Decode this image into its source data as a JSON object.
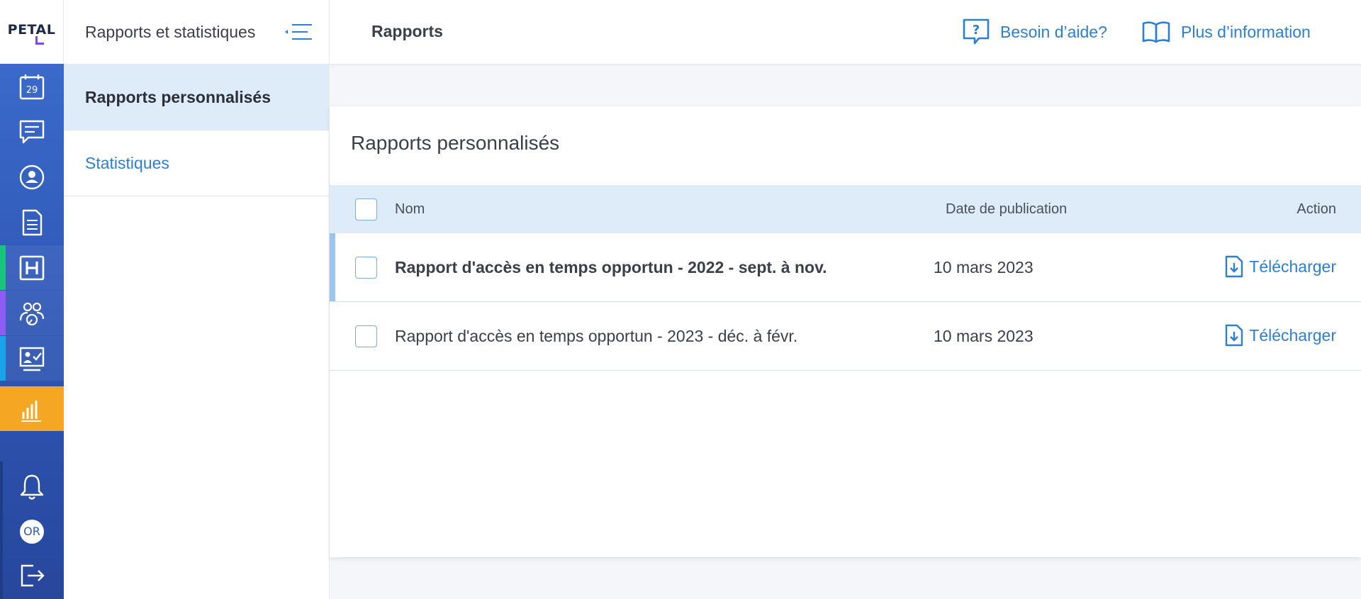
{
  "brand": {
    "logo_text": "PETAL"
  },
  "rail": {
    "calendar_day": "29",
    "avatar_initials": "OR",
    "accent_colors": {
      "green": "#1bc47d",
      "purple": "#8e5cf0",
      "cyan": "#1aa3e8",
      "active": "#f5a623"
    }
  },
  "sidebar": {
    "title": "Rapports et statistiques",
    "items": [
      {
        "label": "Rapports personnalisés",
        "active": true
      },
      {
        "label": "Statistiques",
        "active": false
      }
    ]
  },
  "header": {
    "title": "Rapports",
    "help_label": "Besoin d’aide?",
    "info_label": "Plus d’information"
  },
  "main": {
    "card_title": "Rapports personnalisés",
    "columns": {
      "name": "Nom",
      "date": "Date de publication",
      "action": "Action"
    },
    "rows": [
      {
        "name": "Rapport d'accès en temps opportun - 2022 - sept. à nov.",
        "date": "10 mars 2023",
        "action": "Télécharger",
        "unread": true
      },
      {
        "name": "Rapport d'accès en temps opportun - 2023 - déc. à févr.",
        "date": "10 mars 2023",
        "action": "Télécharger",
        "unread": false
      }
    ]
  }
}
